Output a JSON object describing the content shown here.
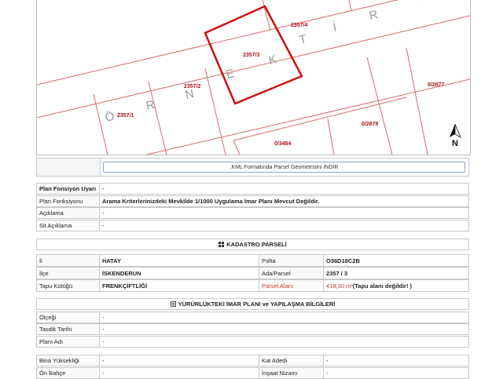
{
  "map": {
    "parcel_labels": [
      "2357/1",
      "2357/2",
      "2357/3",
      "2357/4",
      "0/3484",
      "0/2878",
      "0/2877"
    ],
    "street_letters": [
      "Ö",
      "R",
      "N",
      "E",
      "K",
      "T",
      "İ",
      "R"
    ],
    "north_label": "N"
  },
  "kml_button": ".KML Formatında Parsel Geometrisini İNDİR",
  "plan": {
    "rows": [
      {
        "label": "Plan Fonsiyon Uyarı",
        "value": "-",
        "label_bold": true,
        "value_bold": false
      },
      {
        "label": "Plan Fonksiyonu",
        "value": "Arama Kriterlerinizdeki Mevkilde 1/1000 Uygulama İmar Planı Mevcut Değildir.",
        "label_bold": false,
        "value_bold": true
      },
      {
        "label": "Açıklama",
        "value": "-",
        "label_bold": false,
        "value_bold": false
      },
      {
        "label": "Sit Açıklama",
        "value": "-",
        "label_bold": false,
        "value_bold": false
      }
    ]
  },
  "kadastro": {
    "title": "KADASTRO PARSELİ",
    "rows": [
      {
        "l1": "İl",
        "v1": "HATAY",
        "l2": "Pafta",
        "v2": "O36D18C2B"
      },
      {
        "l1": "İlçe",
        "v1": "İSKENDERUN",
        "l2": "Ada/Parsel",
        "v2": "2357 / 3"
      },
      {
        "l1": "Tapu Kütüğü",
        "v1": "FRENKÇİFTLİĞİ",
        "l2": "Parsel Alanı",
        "v2_area": "418,30 m²",
        "v2_note": " (Tapu alanı değildir! )"
      }
    ]
  },
  "imar": {
    "title": "YÜRÜRLÜKTEKİ İMAR PLANI ve YAPILAŞMA BİLGİLERİ",
    "rows": [
      {
        "label": "Ölçeği",
        "value": "-"
      },
      {
        "label": "Tasdik Tarihi",
        "value": "-"
      },
      {
        "label": "Planı Adı",
        "value": "-"
      }
    ]
  },
  "yapilasma": {
    "rows": [
      {
        "l1": "Bina Yüksekliği",
        "v1": "-",
        "l2": "Kat Adedi",
        "v2": "-"
      },
      {
        "l1": "Ön Bahçe",
        "v1": "-",
        "l2": "İnşaat Nizamı",
        "v2": "-"
      }
    ]
  },
  "colors": {
    "parcel_highlight": "#cc1111",
    "parcel_line": "#d86a6a",
    "label_red": "#aa1111"
  }
}
